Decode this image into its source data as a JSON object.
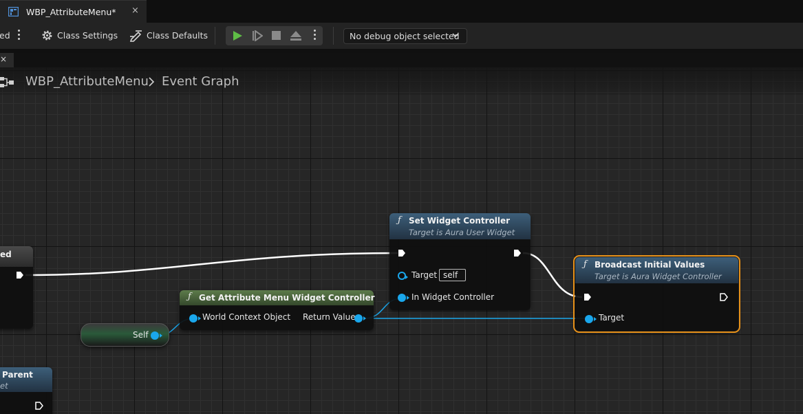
{
  "tab": {
    "title": "WBP_AttributeMenu*",
    "close": "×"
  },
  "toolbar": {
    "cut_label": "ed",
    "class_settings": "Class Settings",
    "class_defaults": "Class Defaults",
    "debug_object": "No debug object selected"
  },
  "panel_close": "×",
  "breadcrumb": {
    "root": "WBP_AttributeMenu",
    "current": "Event Graph"
  },
  "nodes": {
    "event_left": {
      "title": "ed"
    },
    "parent_node": {
      "title": "Parent",
      "subtitle": "et"
    },
    "self_node": {
      "label": "Self"
    },
    "get_controller": {
      "title": "Get Attribute Menu Widget Controller",
      "pin_world_context": "World Context Object",
      "pin_return": "Return Value"
    },
    "set_controller": {
      "title": "Set Widget Controller",
      "subtitle": "Target is Aura User Widget",
      "pin_target": "Target",
      "target_value": "self",
      "pin_in_controller": "In Widget Controller"
    },
    "broadcast": {
      "title": "Broadcast Initial Values",
      "subtitle": "Target is Aura Widget Controller",
      "pin_target": "Target"
    }
  },
  "colors": {
    "function_header": "#3d5f7a",
    "pure_header": "#4c6b3e",
    "data_pin": "#1aa7ec",
    "selection": "#e8921a",
    "exec_wire": "#ffffff"
  }
}
